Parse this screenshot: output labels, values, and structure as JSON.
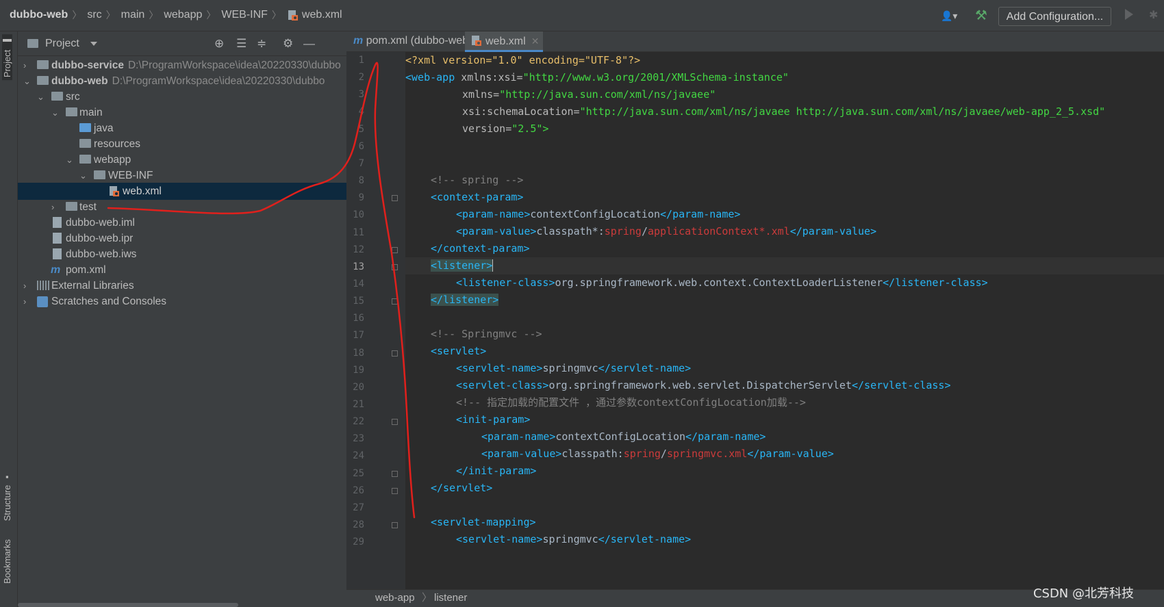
{
  "breadcrumb": {
    "project": "dubbo-web",
    "items": [
      "src",
      "main",
      "webapp",
      "WEB-INF"
    ],
    "file": "web.xml"
  },
  "toolbar": {
    "add_configuration": "Add Configuration..."
  },
  "left_strip": {
    "project_tab": "Project",
    "structure_tab": "Structure",
    "bookmarks_tab": "Bookmarks"
  },
  "project_panel": {
    "title": "Project",
    "tree": [
      {
        "label": "dubbo-service",
        "path": "D:\\ProgramWorkspace\\idea\\20220330\\dubbo",
        "bold": true
      },
      {
        "label": "dubbo-web",
        "path": "D:\\ProgramWorkspace\\idea\\20220330\\dubbo",
        "bold": true
      },
      {
        "label": "src"
      },
      {
        "label": "main"
      },
      {
        "label": "java"
      },
      {
        "label": "resources"
      },
      {
        "label": "webapp"
      },
      {
        "label": "WEB-INF"
      },
      {
        "label": "web.xml"
      },
      {
        "label": "test"
      },
      {
        "label": "dubbo-web.iml"
      },
      {
        "label": "dubbo-web.ipr"
      },
      {
        "label": "dubbo-web.iws"
      },
      {
        "label": "pom.xml"
      },
      {
        "label": "External Libraries"
      },
      {
        "label": "Scratches and Consoles"
      }
    ]
  },
  "tabs": [
    {
      "label": "pom.xml (dubbo-web)",
      "icon": "m",
      "active": false
    },
    {
      "label": "web.xml",
      "icon": "xml",
      "active": true
    }
  ],
  "editor": {
    "current_line": 13,
    "lines": [
      {
        "n": "1"
      },
      {
        "n": "2"
      },
      {
        "n": "3"
      },
      {
        "n": "4"
      },
      {
        "n": "5"
      },
      {
        "n": "6"
      },
      {
        "n": "7"
      },
      {
        "n": "8"
      },
      {
        "n": "9"
      },
      {
        "n": "10"
      },
      {
        "n": "11"
      },
      {
        "n": "12"
      },
      {
        "n": "13"
      },
      {
        "n": "14"
      },
      {
        "n": "15"
      },
      {
        "n": "16"
      },
      {
        "n": "17"
      },
      {
        "n": "18"
      },
      {
        "n": "19"
      },
      {
        "n": "20"
      },
      {
        "n": "21"
      },
      {
        "n": "22"
      },
      {
        "n": "23"
      },
      {
        "n": "24"
      },
      {
        "n": "25"
      },
      {
        "n": "26"
      },
      {
        "n": "27"
      },
      {
        "n": "28"
      },
      {
        "n": "29"
      }
    ],
    "code": {
      "l1": "<?xml version=\"1.0\" encoding=\"UTF-8\"?>",
      "l2_tag": "<web-app",
      "l2_attr": " xmlns:xsi=",
      "l2_val": "\"http://www.w3.org/2001/XMLSchema-instance\"",
      "l3_attr": "xmlns=",
      "l3_val": "\"http://java.sun.com/xml/ns/javaee\"",
      "l4_attr": "xsi:schemaLocation=",
      "l4_val": "\"http://java.sun.com/xml/ns/javaee http://java.sun.com/xml/ns/javaee/web-app_2_5.xsd\"",
      "l5_attr": "version=",
      "l5_val": "\"2.5\">",
      "l8": "<!-- spring -->",
      "l9": "<context-param>",
      "l10_o": "<param-name>",
      "l10_t": "contextConfigLocation",
      "l10_c": "</param-name>",
      "l11_o": "<param-value>",
      "l11_t": "classpath*:",
      "l11_r1": "spring",
      "l11_s": "/",
      "l11_r2": "applicationContext*.xml",
      "l11_c": "</param-value>",
      "l12": "</context-param>",
      "l13": "<listener>",
      "l14_o": "<listener-class>",
      "l14_t": "org.springframework.web.context.ContextLoaderListener",
      "l14_c": "</listener-class>",
      "l15": "</listener>",
      "l17": "<!-- Springmvc -->",
      "l18": "<servlet>",
      "l19_o": "<servlet-name>",
      "l19_t": "springmvc",
      "l19_c": "</servlet-name>",
      "l20_o": "<servlet-class>",
      "l20_t": "org.springframework.web.servlet.DispatcherServlet",
      "l20_c": "</servlet-class>",
      "l21": "<!-- 指定加载的配置文件 ，通过参数contextConfigLocation加载-->",
      "l22": "<init-param>",
      "l23_o": "<param-name>",
      "l23_t": "contextConfigLocation",
      "l23_c": "</param-name>",
      "l24_o": "<param-value>",
      "l24_t": "classpath:",
      "l24_r1": "spring",
      "l24_s": "/",
      "l24_r2": "springmvc.xml",
      "l24_c": "</param-value>",
      "l25": "</init-param>",
      "l26": "</servlet>",
      "l28": "<servlet-mapping>",
      "l29_o": "<servlet-name>",
      "l29_t": "springmvc",
      "l29_c": "</servlet-name>"
    }
  },
  "status": {
    "path1": "web-app",
    "path2": "listener"
  },
  "watermark": "CSDN @北芳科技",
  "colors": {
    "tag": "#29b6f6",
    "value": "#43d843",
    "comment": "#808080",
    "annotation": "#e0201c"
  }
}
